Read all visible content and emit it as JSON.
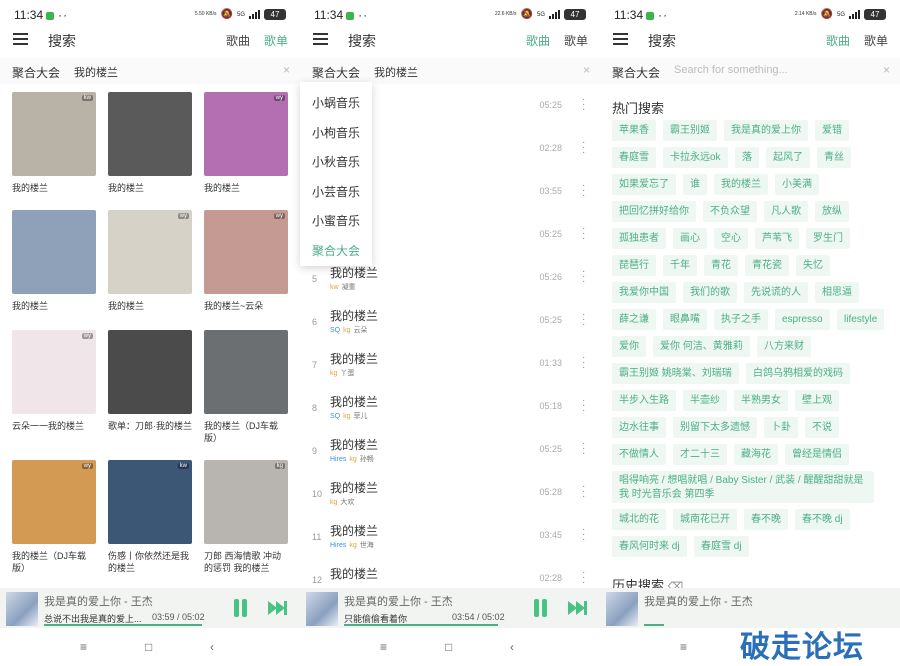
{
  "status": {
    "time": "11:34",
    "s1": {
      "speed": "5.50 KB/s",
      "battery": "47"
    },
    "s2": {
      "speed": "22.6 KB/s",
      "battery": "47"
    },
    "s3": {
      "speed": "2.14 KB/s",
      "battery": "47"
    },
    "signal": "5G"
  },
  "header": {
    "title": "搜索",
    "tab_song": "歌曲",
    "tab_playlist": "歌单"
  },
  "search": {
    "source": "聚合大会",
    "query": "我的楼兰",
    "placeholder": "Search for something..."
  },
  "playlists": [
    {
      "title": "我的楼兰",
      "badge": "kw",
      "color": "#b9b2a6"
    },
    {
      "title": "我的楼兰",
      "badge": "",
      "color": "#5a5a5a"
    },
    {
      "title": "我的楼兰",
      "badge": "wy",
      "color": "#b46fb2"
    },
    {
      "title": "我的楼兰",
      "badge": "",
      "color": "#8fa1b8"
    },
    {
      "title": "我的楼兰",
      "badge": "wy",
      "color": "#d7d2c8"
    },
    {
      "title": "我的楼兰~云朵",
      "badge": "wy",
      "color": "#c59a92"
    },
    {
      "title": "云朵一一我的楼兰",
      "badge": "wy",
      "color": "#f0e6ea"
    },
    {
      "title": "歌单：刀郎·我的楼兰",
      "badge": "",
      "color": "#4b4b4b"
    },
    {
      "title": "我的楼兰（DJ车载版）",
      "badge": "",
      "color": "#6b6f72"
    },
    {
      "title": "我的楼兰（DJ车载版）",
      "badge": "wy",
      "color": "#d39a53"
    },
    {
      "title": "伤感丨你依然还是我的楼兰",
      "badge": "kw",
      "color": "#3c5776"
    },
    {
      "title": "刀郎 西海情歌 冲动的惩罚 我的楼兰",
      "badge": "kg",
      "color": "#b8b4b0"
    }
  ],
  "sources": [
    "小蜗音乐",
    "小枸音乐",
    "小秋音乐",
    "小芸音乐",
    "小蜜音乐",
    "聚合大会"
  ],
  "songs": [
    {
      "n": "",
      "title": "",
      "tags": [],
      "artist": "",
      "dur": "05:25"
    },
    {
      "n": "",
      "title": "",
      "tags": [],
      "artist": "",
      "dur": "02:28"
    },
    {
      "n": "",
      "title": "",
      "tags": [],
      "artist": "",
      "dur": "03:55"
    },
    {
      "n": "",
      "title": "",
      "tags": [],
      "artist": "",
      "dur": "05:25"
    },
    {
      "n": "5",
      "title": "我的楼兰",
      "tags": [
        "kw"
      ],
      "artist": "凝重",
      "dur": "05:26"
    },
    {
      "n": "6",
      "title": "我的楼兰",
      "tags": [
        "SQ",
        "kg"
      ],
      "artist": "云朵",
      "dur": "05:25"
    },
    {
      "n": "7",
      "title": "我的楼兰",
      "tags": [
        "kg"
      ],
      "artist": "丫蛋",
      "dur": "01:33"
    },
    {
      "n": "8",
      "title": "我的楼兰",
      "tags": [
        "SQ",
        "kg"
      ],
      "artist": "菲儿",
      "dur": "05:18"
    },
    {
      "n": "9",
      "title": "我的楼兰",
      "tags": [
        "Hires",
        "kg"
      ],
      "artist": "孙畅",
      "dur": "05:25"
    },
    {
      "n": "10",
      "title": "我的楼兰",
      "tags": [
        "kg"
      ],
      "artist": "大欢",
      "dur": "05:28"
    },
    {
      "n": "11",
      "title": "我的楼兰",
      "tags": [
        "Hires",
        "kg"
      ],
      "artist": "世海",
      "dur": "03:45"
    },
    {
      "n": "12",
      "title": "我的楼兰",
      "tags": [],
      "artist": "",
      "dur": "02:28"
    }
  ],
  "hot": {
    "title": "热门搜索",
    "chips": [
      "苹果香",
      "霸王别姬",
      "我是真的爱上你",
      "爱错",
      "春庭雪",
      "卡拉永远ok",
      "落",
      "起风了",
      "青丝",
      "如果爱忘了",
      "谁",
      "我的楼兰",
      "小美满",
      "把回忆拼好给你",
      "不负众望",
      "凡人歌",
      "放纵",
      "孤独患者",
      "画心",
      "空心",
      "芦苇飞",
      "罗生门",
      "琵琶行",
      "千年",
      "青花",
      "青花瓷",
      "失忆",
      "我爱你中国",
      "我们的歌",
      "先说谎的人",
      "相思逼",
      "薛之谦",
      "眼鼻嘴",
      "执子之手",
      "espresso",
      "lifestyle",
      "爱你",
      "爱你 何洁、黄雅莉",
      "八方来财",
      "霸王别姬 姚晓棠、刘瑞瑞",
      "白鸽乌鸦相爱的戏码",
      "半步入生路",
      "半壶纱",
      "半熟男女",
      "壁上观",
      "边水往事",
      "别留下太多遗憾",
      "卜卦",
      "不说",
      "不做情人",
      "才二十三",
      "藏海花",
      "曾经是情侣",
      "唱得响亮 / 想唱就唱 / Baby Sister / 武装 / 醒醒甜甜就是我 时光音乐会 第四季",
      "城北的花",
      "城南花已开",
      "春不晚",
      "春不晚 dj",
      "春风何时来 dj",
      "春庭雪 dj"
    ]
  },
  "history": {
    "title": "历史搜索"
  },
  "players": [
    {
      "song": "我是真的爱上你 - 王杰",
      "lyric": "总说不出我是真的爱上...",
      "cur": "03:59",
      "total": "05:02",
      "progress": 0.79
    },
    {
      "song": "我是真的爱上你 - 王杰",
      "lyric": "只能偷偷看着你",
      "cur": "03:54",
      "total": "05:02",
      "progress": 0.77
    },
    {
      "song": "我是真的爱上你 - 王杰",
      "lyric": "",
      "cur": "",
      "total": "",
      "progress": 0.1
    }
  ],
  "nav": {
    "menu": "≡",
    "home": "□",
    "back": "‹"
  },
  "watermark": "破走论坛",
  "colors": {
    "accent": "#4caf88",
    "chip_bg": "#eef7f2"
  }
}
